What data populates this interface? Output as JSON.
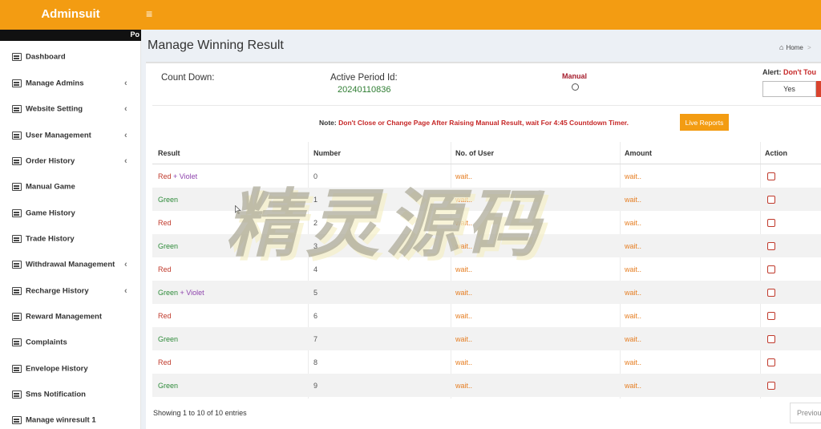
{
  "brand": "Adminsuit",
  "menu_icon": "bars-icon",
  "subbar_text": "Po",
  "sidebar": {
    "items": [
      {
        "label": "Dashboard",
        "icon": "list-icon",
        "chevron": ""
      },
      {
        "label": "Manage Admins",
        "icon": "list-icon",
        "chevron": "‹"
      },
      {
        "label": "Website Setting",
        "icon": "list-icon",
        "chevron": "‹"
      },
      {
        "label": "User Management",
        "icon": "list-icon",
        "chevron": "‹"
      },
      {
        "label": "Order History",
        "icon": "list-icon",
        "chevron": "‹"
      },
      {
        "label": "Manual Game",
        "icon": "list-icon",
        "chevron": ""
      },
      {
        "label": "Game History",
        "icon": "list-icon",
        "chevron": ""
      },
      {
        "label": "Trade History",
        "icon": "list-icon",
        "chevron": ""
      },
      {
        "label": "Withdrawal Management",
        "icon": "list-icon",
        "chevron": "‹"
      },
      {
        "label": "Recharge History",
        "icon": "list-icon",
        "chevron": "‹"
      },
      {
        "label": "Reward Management",
        "icon": "list-icon",
        "chevron": ""
      },
      {
        "label": "Complaints",
        "icon": "list-icon",
        "chevron": ""
      },
      {
        "label": "Envelope History",
        "icon": "list-icon",
        "chevron": ""
      },
      {
        "label": "Sms Notification",
        "icon": "list-icon",
        "chevron": ""
      },
      {
        "label": "Manage winresult 1",
        "icon": "list-icon",
        "chevron": ""
      }
    ]
  },
  "page": {
    "title": "Manage Winning Result",
    "breadcrumb": {
      "home": "Home",
      "separator": ">",
      "icon": "dashboard-icon"
    }
  },
  "panel": {
    "countdown_label": "Count Down:",
    "active_period_label": "Active Period Id:",
    "active_period_value": "20240110836",
    "manual_label": "Manual",
    "alert_label": "Alert:",
    "alert_text": "Don't Tou",
    "yes_button": "Yes"
  },
  "note": {
    "prefix": "Note:",
    "text": "Don't Close or Change Page After Raising Manual Result, wait For 4:45 Countdown Timer.",
    "live_reports_button": "Live Reports"
  },
  "table": {
    "headers": [
      "Result",
      "Number",
      "No. of User",
      "Amount",
      "Action"
    ],
    "rows": [
      {
        "result_a": "Red",
        "sep": " + ",
        "result_b": "Violet",
        "number": "0",
        "users": "wait..",
        "amount": "wait.."
      },
      {
        "result_a": "Green",
        "sep": "",
        "result_b": "",
        "number": "1",
        "users": "wait..",
        "amount": "wait.."
      },
      {
        "result_a": "Red",
        "sep": "",
        "result_b": "",
        "number": "2",
        "users": "wait..",
        "amount": "wait.."
      },
      {
        "result_a": "Green",
        "sep": "",
        "result_b": "",
        "number": "3",
        "users": "wait..",
        "amount": "wait.."
      },
      {
        "result_a": "Red",
        "sep": "",
        "result_b": "",
        "number": "4",
        "users": "wait..",
        "amount": "wait.."
      },
      {
        "result_a": "Green",
        "sep": " + ",
        "result_b": "Violet",
        "number": "5",
        "users": "wait..",
        "amount": "wait.."
      },
      {
        "result_a": "Red",
        "sep": "",
        "result_b": "",
        "number": "6",
        "users": "wait..",
        "amount": "wait.."
      },
      {
        "result_a": "Green",
        "sep": "",
        "result_b": "",
        "number": "7",
        "users": "wait..",
        "amount": "wait.."
      },
      {
        "result_a": "Red",
        "sep": "",
        "result_b": "",
        "number": "8",
        "users": "wait..",
        "amount": "wait.."
      },
      {
        "result_a": "Green",
        "sep": "",
        "result_b": "",
        "number": "9",
        "users": "wait..",
        "amount": "wait.."
      }
    ],
    "info": "Showing 1 to 10 of 10 entries",
    "prev_button": "Previou"
  },
  "watermark": "精灵源码",
  "colors": {
    "accent": "#f39c12",
    "green": "#2e8b3a",
    "red": "#c0392b",
    "violet": "#8e44ad",
    "wait": "#e67e22"
  }
}
